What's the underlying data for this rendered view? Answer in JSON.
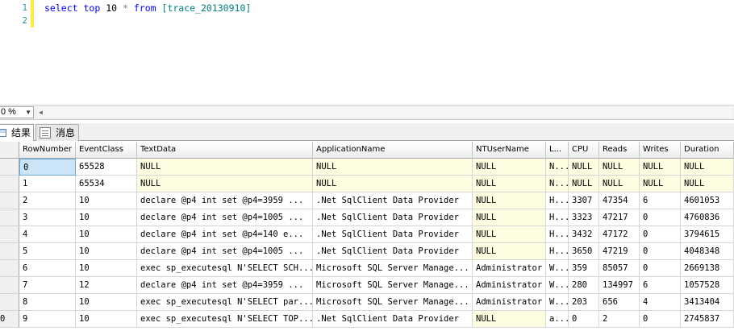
{
  "editor": {
    "line_numbers": [
      "1",
      "2"
    ],
    "query": {
      "kw_select": "select",
      "kw_top": "top",
      "num": "10",
      "star": "*",
      "kw_from": "from",
      "table": "[trace_20130910]"
    }
  },
  "zoom": {
    "value": "0 %"
  },
  "tabs": [
    {
      "label": "结果"
    },
    {
      "label": "消息"
    }
  ],
  "columns": [
    "RowNumber",
    "EventClass",
    "TextData",
    "ApplicationName",
    "NTUserName",
    "L...",
    "CPU",
    "Reads",
    "Writes",
    "Duration"
  ],
  "rows": [
    {
      "rowhdr": "",
      "cells": [
        "0",
        "65528",
        "NULL",
        "NULL",
        "NULL",
        "N...",
        "NULL",
        "NULL",
        "NULL",
        "NULL"
      ],
      "null": [
        false,
        false,
        true,
        true,
        true,
        true,
        true,
        true,
        true,
        true
      ]
    },
    {
      "rowhdr": "",
      "cells": [
        "1",
        "65534",
        "NULL",
        "NULL",
        "NULL",
        "N...",
        "NULL",
        "NULL",
        "NULL",
        "NULL"
      ],
      "null": [
        false,
        false,
        true,
        true,
        true,
        true,
        true,
        true,
        true,
        true
      ]
    },
    {
      "rowhdr": "",
      "cells": [
        "2",
        "10",
        "declare @p4 int  set @p4=3959  ...",
        ".Net SqlClient Data Provider",
        "NULL",
        "H...",
        "3307",
        "47354",
        "6",
        "4601053"
      ],
      "null": [
        false,
        false,
        false,
        false,
        true,
        false,
        false,
        false,
        false,
        false
      ]
    },
    {
      "rowhdr": "",
      "cells": [
        "3",
        "10",
        "declare @p4 int  set @p4=1005  ...",
        ".Net SqlClient Data Provider",
        "NULL",
        "H...",
        "3323",
        "47217",
        "0",
        "4760836"
      ],
      "null": [
        false,
        false,
        false,
        false,
        true,
        false,
        false,
        false,
        false,
        false
      ]
    },
    {
      "rowhdr": "",
      "cells": [
        "4",
        "10",
        "declare @p4 int  set @p4=140  e...",
        ".Net SqlClient Data Provider",
        "NULL",
        "H...",
        "3432",
        "47172",
        "0",
        "3794615"
      ],
      "null": [
        false,
        false,
        false,
        false,
        true,
        false,
        false,
        false,
        false,
        false
      ]
    },
    {
      "rowhdr": "",
      "cells": [
        "5",
        "10",
        "declare @p4 int  set @p4=1005  ...",
        ".Net SqlClient Data Provider",
        "NULL",
        "H...",
        "3650",
        "47219",
        "0",
        "4048348"
      ],
      "null": [
        false,
        false,
        false,
        false,
        true,
        false,
        false,
        false,
        false,
        false
      ]
    },
    {
      "rowhdr": "",
      "cells": [
        "6",
        "10",
        "exec sp_executesql N'SELECT SCH...",
        "Microsoft SQL Server Manage...",
        "Administrator",
        "W...",
        "359",
        "85057",
        "0",
        "2669138"
      ],
      "null": [
        false,
        false,
        false,
        false,
        false,
        false,
        false,
        false,
        false,
        false
      ]
    },
    {
      "rowhdr": "",
      "cells": [
        "7",
        "12",
        "declare @p4 int  set @p4=3959  ...",
        "Microsoft SQL Server Manage...",
        "Administrator",
        "W...",
        "280",
        "134997",
        "6",
        "1057528"
      ],
      "null": [
        false,
        false,
        false,
        false,
        false,
        false,
        false,
        false,
        false,
        false
      ]
    },
    {
      "rowhdr": "",
      "cells": [
        "8",
        "10",
        "exec sp_executesql N'SELECT par...",
        "Microsoft SQL Server Manage...",
        "Administrator",
        "W...",
        "203",
        "656",
        "4",
        "3413404"
      ],
      "null": [
        false,
        false,
        false,
        false,
        false,
        false,
        false,
        false,
        false,
        false
      ]
    },
    {
      "rowhdr": "0",
      "cells": [
        "9",
        "10",
        "exec sp_executesql N'SELECT TOP...",
        ".Net SqlClient Data Provider",
        "NULL",
        "a...",
        "0",
        "2",
        "0",
        "2745837"
      ],
      "null": [
        false,
        false,
        false,
        false,
        true,
        false,
        false,
        false,
        false,
        false
      ]
    }
  ],
  "colors": {
    "null_cell": "#fffde1",
    "selected_cell": "#cce4f7",
    "keyword": "#0000ff",
    "identifier": "#008080",
    "line_number": "#2b91af",
    "change_bar": "#ffeb3b"
  }
}
